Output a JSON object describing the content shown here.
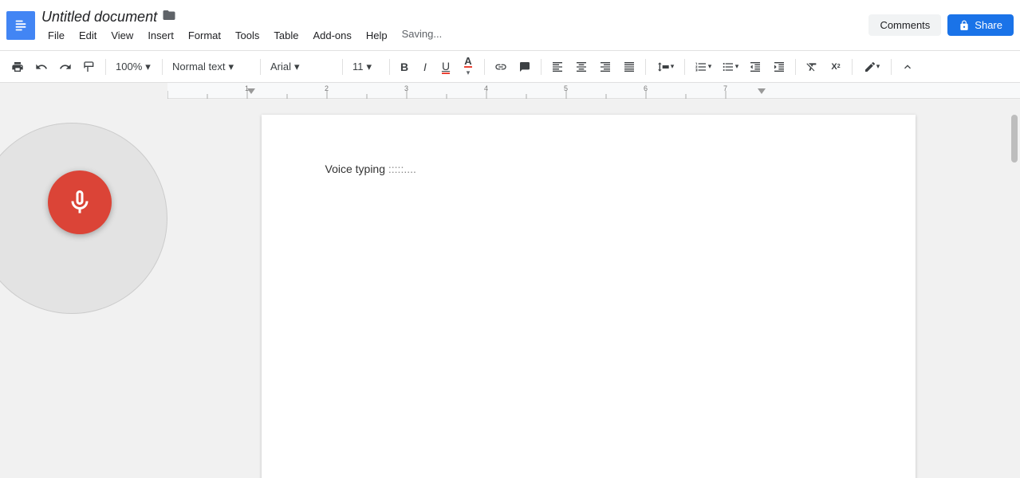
{
  "app": {
    "icon_label": "Google Docs",
    "title": "Untitled document",
    "saving_status": "Saving..."
  },
  "menu": {
    "items": [
      "File",
      "Edit",
      "View",
      "Insert",
      "Format",
      "Tools",
      "Table",
      "Add-ons",
      "Help"
    ]
  },
  "header_actions": {
    "comments_label": "Comments",
    "share_label": "Share"
  },
  "toolbar": {
    "zoom": "100%",
    "zoom_arrow": "▾",
    "style": "Normal text",
    "style_arrow": "▾",
    "font": "Arial",
    "font_arrow": "▾",
    "size": "11",
    "size_arrow": "▾",
    "bold": "B",
    "italic": "I",
    "underline": "U",
    "text_color": "A",
    "more_label": "⋮"
  },
  "document": {
    "content": "Voice typing",
    "voice_placeholder": ":::::...."
  },
  "voice_typing": {
    "mic_label": "Microphone",
    "active": true
  },
  "colors": {
    "share_bg": "#1a73e8",
    "mic_bg": "#db4437",
    "app_icon_bg": "#4285f4",
    "underline_color": "#ea4335"
  }
}
